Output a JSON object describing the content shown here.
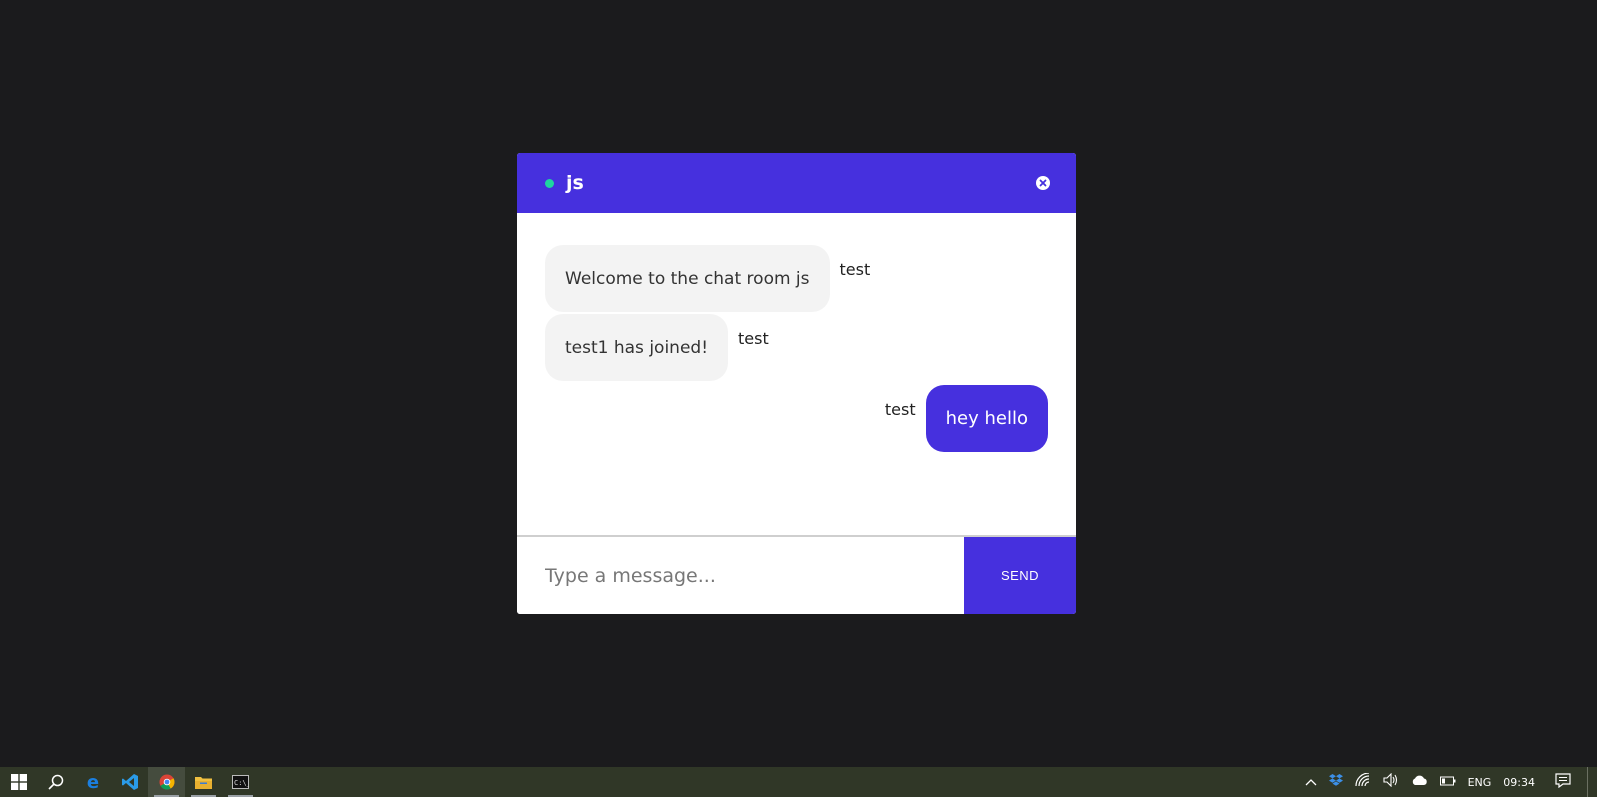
{
  "chat": {
    "room_title": "js",
    "status": "online",
    "input_placeholder": "Type a message...",
    "send_label": "SEND",
    "messages": [
      {
        "text": "Welcome to the chat room js",
        "sender": "test",
        "own": false
      },
      {
        "text": "test1 has joined!",
        "sender": "test",
        "own": false
      },
      {
        "text": "hey hello",
        "sender": "test",
        "own": true
      }
    ]
  },
  "taskbar": {
    "apps": [
      "windows-start-icon",
      "search-icon",
      "edge-icon",
      "vscode-icon",
      "chrome-icon",
      "file-explorer-icon",
      "terminal-icon"
    ],
    "language": "ENG",
    "time": "09:34"
  },
  "colors": {
    "accent": "#4630de",
    "status_online": "#1ed6a0",
    "background": "#1b1b1d",
    "taskbar": "#303727"
  }
}
